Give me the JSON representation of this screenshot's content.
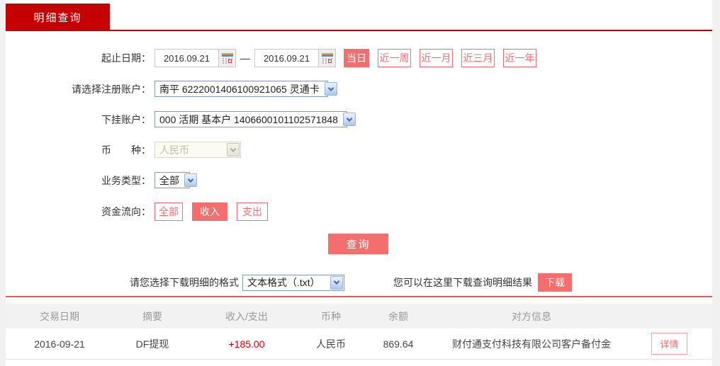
{
  "tab": {
    "title": "明细查询"
  },
  "form": {
    "date_range": {
      "label": "起止日期：",
      "start": "2016.09.21",
      "end": "2016.09.21",
      "separator": "—",
      "quick_buttons": [
        {
          "label": "当日",
          "active": true
        },
        {
          "label": "近一周",
          "active": false
        },
        {
          "label": "近一月",
          "active": false
        },
        {
          "label": "近三月",
          "active": false
        },
        {
          "label": "近一年",
          "active": false
        }
      ]
    },
    "register_account": {
      "label": "请选择注册账户：",
      "value": "南平 6222001406100921065 灵通卡"
    },
    "sub_account": {
      "label": "下挂账户：",
      "value": "000 活期 基本户 1406600101102571848"
    },
    "currency": {
      "label": "币　　种：",
      "value": "人民币",
      "disabled": true
    },
    "business_type": {
      "label": "业务类型：",
      "value": "全部"
    },
    "fund_flow": {
      "label": "资金流向：",
      "options": [
        {
          "label": "全部",
          "active": false
        },
        {
          "label": "收入",
          "active": true
        },
        {
          "label": "支出",
          "active": false
        }
      ]
    },
    "query_button": "查询"
  },
  "download": {
    "format_label": "请您选择下载明细的格式",
    "format_value": "文本格式（.txt）",
    "hint": "您可以在这里下载查询明细结果",
    "button": "下载"
  },
  "table": {
    "headers": [
      "交易日期",
      "摘要",
      "收入/支出",
      "币种",
      "余额",
      "对方信息"
    ],
    "rows": [
      {
        "date": "2016-09-21",
        "summary": "DF提现",
        "amount": "+185.00",
        "currency": "人民币",
        "balance": "869.64",
        "counterparty": "财付通支付科技有限公司客户备付金",
        "detail_button": "详情"
      }
    ]
  },
  "colors": {
    "brand_red": "#c40000",
    "accent_salmon": "#f56e6e",
    "amount_red": "#d40000",
    "divider_red": "#ee5555"
  }
}
